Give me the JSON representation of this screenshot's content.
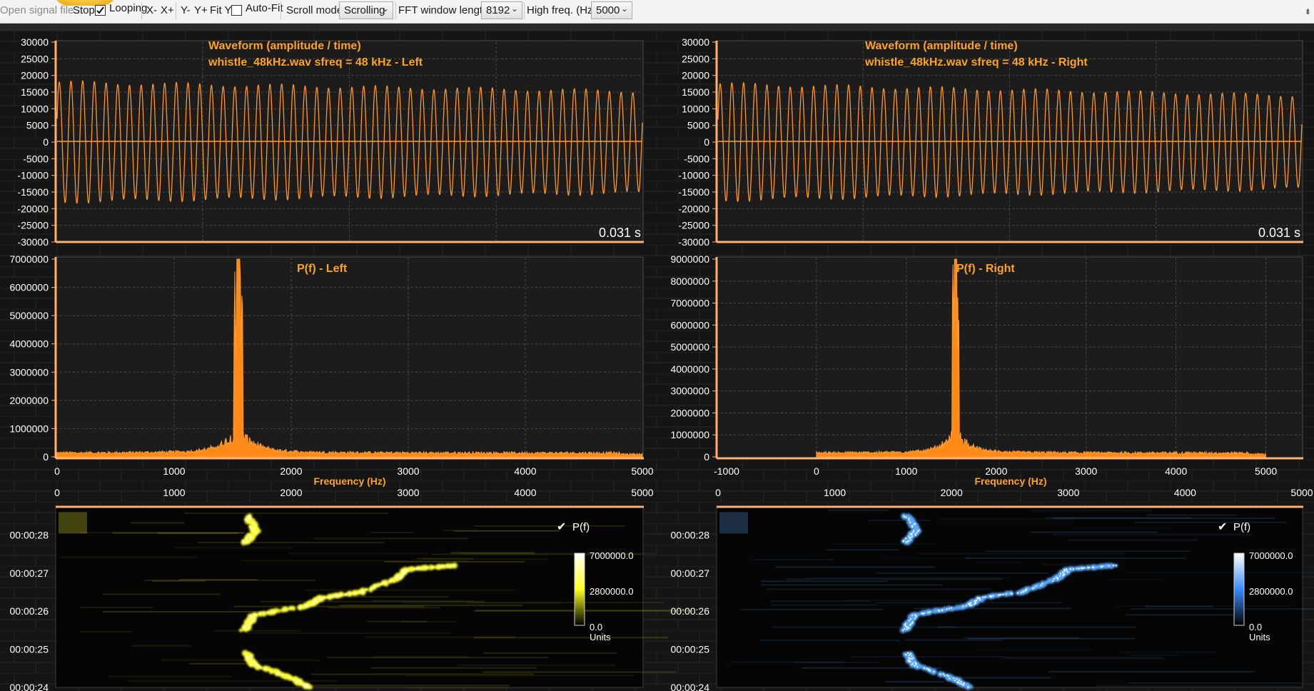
{
  "toolbar": {
    "open_label": "Open signal file...",
    "stop_label": "Stop",
    "looping_label": "Looping",
    "looping_checked": true,
    "x_minus": "X-",
    "x_plus": "X+",
    "y_minus": "Y-",
    "y_plus": "Y+",
    "fit_y": "Fit Y",
    "autofit_label": "Auto-Fit",
    "autofit_checked": false,
    "scroll_mode_label": "Scroll mode:",
    "scroll_mode_value": "Scrolling",
    "fft_label": "FFT window length:",
    "fft_value": "8192",
    "high_freq_label": "High freq. (Hz):",
    "high_freq_value": "5000"
  },
  "colors": {
    "accent": "#ff9620",
    "title_text": "#ffa31a",
    "axis_text": "#ffffff",
    "grid": "#5a5a5a",
    "plot_background": "#1e1e1e",
    "spectrogram_left": "#ffff30",
    "spectrogram_right": "#5aa8ff"
  },
  "panels": {
    "waveform_left": {
      "title_line1": "Waveform (amplitude / time)",
      "title_line2": "whistle_48kHz.wav sfreq = 48 kHz - Left",
      "time_label": "0.031 s",
      "y_ticks": [
        "30000",
        "25000",
        "20000",
        "15000",
        "10000",
        "5000",
        "0",
        "-5000",
        "-10000",
        "-15000",
        "-20000",
        "-25000",
        "-30000"
      ],
      "chart_data": {
        "type": "line",
        "title": "Waveform (amplitude / time)",
        "ylim": [
          -30000,
          30000
        ],
        "cycles_visible": 50,
        "amplitude": 18500,
        "duration_s": 0.031
      }
    },
    "waveform_right": {
      "title_line1": "Waveform (amplitude / time)",
      "title_line2": "whistle_48kHz.wav sfreq = 48 kHz - Right",
      "time_label": "0.031 s",
      "y_ticks": [
        "30000",
        "25000",
        "20000",
        "15000",
        "10000",
        "5000",
        "0",
        "-5000",
        "-10000",
        "-15000",
        "-20000",
        "-25000",
        "-30000"
      ],
      "chart_data": {
        "type": "line",
        "title": "Waveform (amplitude / time)",
        "ylim": [
          -30000,
          30000
        ],
        "cycles_visible": 50,
        "amplitude": 18000,
        "duration_s": 0.031
      }
    },
    "spectrum_left": {
      "title": "P(f) - Left",
      "xlabel": "Frequency (Hz)",
      "y_ticks": [
        "7000000",
        "6000000",
        "5000000",
        "4000000",
        "3000000",
        "2000000",
        "1000000",
        "0"
      ],
      "x_ticks": [
        "0",
        "1000",
        "2000",
        "3000",
        "4000",
        "5000"
      ],
      "chart_data": {
        "type": "line",
        "xlim": [
          0,
          5000
        ],
        "ylim": [
          0,
          7000000
        ],
        "peak_hz": 1550,
        "peak_value": 7000000
      }
    },
    "spectrum_right": {
      "title": "P(f) - Right",
      "xlabel": "Frequency (Hz)",
      "y_ticks": [
        "9000000",
        "8000000",
        "7000000",
        "6000000",
        "5000000",
        "4000000",
        "3000000",
        "2000000",
        "1000000",
        "0"
      ],
      "x_ticks": [
        "-1000",
        "0",
        "1000",
        "2000",
        "3000",
        "4000",
        "5000"
      ],
      "chart_data": {
        "type": "line",
        "xlim": [
          -1000,
          5400
        ],
        "ylim": [
          0,
          9000000
        ],
        "peak_hz": 1550,
        "peak_value": 9000000
      }
    },
    "spectrogram_left": {
      "legend_label": "P(f)",
      "scale_max": "7000000.0",
      "scale_mid": "2800000.0",
      "scale_min": "0.0",
      "units": "Units",
      "x_ticks": [
        "0",
        "1000",
        "2000",
        "3000",
        "4000",
        "5000"
      ],
      "y_ticks": [
        "00:00:28",
        "00:00:27",
        "00:00:26",
        "00:00:25",
        "00:00:24"
      ],
      "chart_data": {
        "type": "heatmap",
        "xlim": [
          0,
          5000
        ],
        "track_hz": [
          [
            24.0,
            2150
          ],
          [
            24.25,
            2000
          ],
          [
            24.6,
            1680
          ],
          [
            24.9,
            1620
          ],
          [
            25.5,
            1600
          ],
          [
            25.9,
            1680
          ],
          [
            26.15,
            2150
          ],
          [
            26.35,
            2250
          ],
          [
            26.5,
            2600
          ],
          [
            26.85,
            2900
          ],
          [
            27.1,
            3000
          ],
          [
            27.2,
            3400
          ],
          [
            27.8,
            1600
          ],
          [
            28.1,
            1700
          ],
          [
            28.5,
            1620
          ]
        ]
      }
    },
    "spectrogram_right": {
      "legend_label": "P(f)",
      "scale_max": "7000000.0",
      "scale_mid": "2800000.0",
      "scale_min": "0.0",
      "units": "Units",
      "x_ticks": [
        "0",
        "1000",
        "2000",
        "3000",
        "4000",
        "5000"
      ],
      "y_ticks": [
        "00:00:28",
        "00:00:27",
        "00:00:26",
        "00:00:25",
        "00:00:24"
      ],
      "chart_data": {
        "type": "heatmap",
        "xlim": [
          0,
          5000
        ],
        "track_hz": [
          [
            24.0,
            2150
          ],
          [
            24.25,
            2000
          ],
          [
            24.6,
            1680
          ],
          [
            24.9,
            1620
          ],
          [
            25.5,
            1600
          ],
          [
            25.9,
            1680
          ],
          [
            26.15,
            2150
          ],
          [
            26.35,
            2250
          ],
          [
            26.5,
            2600
          ],
          [
            26.85,
            2900
          ],
          [
            27.1,
            3000
          ],
          [
            27.2,
            3400
          ],
          [
            27.8,
            1600
          ],
          [
            28.1,
            1700
          ],
          [
            28.5,
            1620
          ]
        ]
      }
    }
  }
}
